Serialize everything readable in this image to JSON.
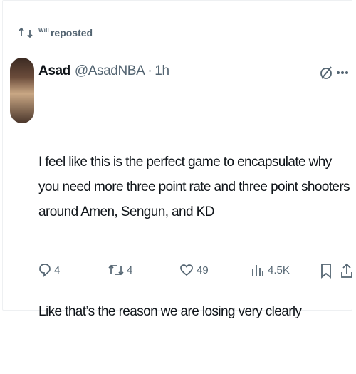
{
  "repost": {
    "who": "Will",
    "label": "reposted"
  },
  "tweet": {
    "name": "Asad",
    "handle": "@AsadNBA",
    "separator": "·",
    "time": "1h",
    "paragraphs": [
      "I feel like this is the perfect game to encapsulate why you need more three point rate and three point shooters around Amen, Sengun, and KD",
      "Like that’s the reason we are losing very clearly"
    ]
  },
  "actions": {
    "replies": "4",
    "retweets": "4",
    "likes": "49",
    "views": "4.5K"
  },
  "colors": {
    "text": "#0f1419",
    "muted": "#536471"
  }
}
